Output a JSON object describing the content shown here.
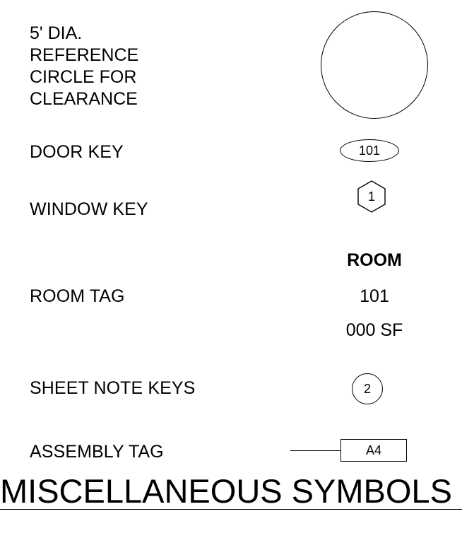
{
  "reference_circle": {
    "label_lines": [
      "5' DIA.",
      "REFERENCE",
      "CIRCLE FOR",
      "CLEARANCE"
    ]
  },
  "door_key": {
    "label": "DOOR KEY",
    "symbol_text": "101"
  },
  "window_key": {
    "label": "WINDOW KEY",
    "symbol_text": "1"
  },
  "room_tag": {
    "label": "ROOM TAG",
    "name": "ROOM",
    "number": "101",
    "area": "000 SF"
  },
  "sheet_note_keys": {
    "label": "SHEET NOTE KEYS",
    "symbol_text": "2"
  },
  "assembly_tag": {
    "label": "ASSEMBLY TAG",
    "symbol_text": "A4"
  },
  "title": "MISCELLANEOUS SYMBOLS"
}
